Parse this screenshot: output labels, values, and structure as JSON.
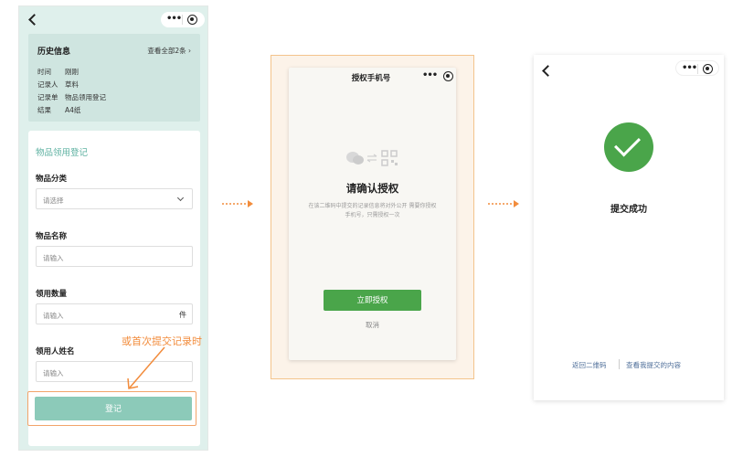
{
  "screen1": {
    "history": {
      "title": "历史信息",
      "view_all": "查看全部2条 ›",
      "rows": [
        {
          "key": "时间",
          "value": "刚刚"
        },
        {
          "key": "记录人",
          "value": "草料"
        },
        {
          "key": "记录单",
          "value": "物品领用登记"
        },
        {
          "key": "结果",
          "value": "A4纸"
        }
      ]
    },
    "form": {
      "title": "物品领用登记",
      "category_label": "物品分类",
      "category_placeholder": "请选择",
      "name_label": "物品名称",
      "name_placeholder": "请输入",
      "quantity_label": "领用数量",
      "quantity_placeholder": "请输入",
      "quantity_unit": "件",
      "person_label": "领用人姓名",
      "person_placeholder": "请输入",
      "submit_label": "登记"
    },
    "annotation": "或首次提交记录时"
  },
  "screen2": {
    "title": "授权手机号",
    "heading": "请确认授权",
    "description": "在该二维码中提交的记录信息将对外公开 需要你授权手机号，只需授权一次",
    "authorize_label": "立即授权",
    "cancel_label": "取消"
  },
  "screen3": {
    "heading": "提交成功",
    "back_link": "返回二维码",
    "view_link": "查看我提交的内容"
  },
  "colors": {
    "accent_teal": "#8ccab9",
    "wechat_green": "#4aa54a",
    "highlight_orange": "#f28c3c"
  }
}
